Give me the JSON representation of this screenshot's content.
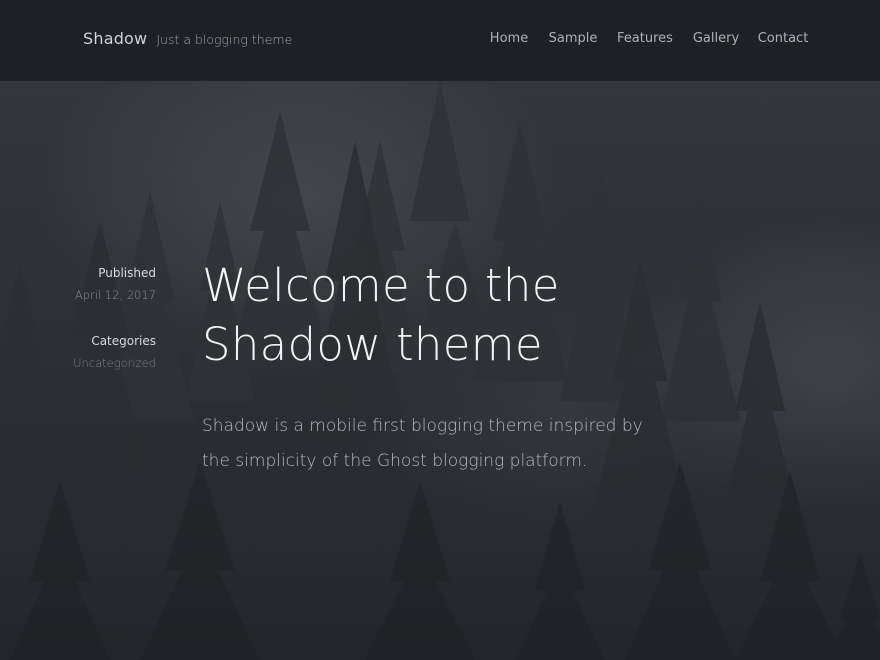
{
  "site": {
    "title": "Shadow",
    "tagline": "Just a blogging theme"
  },
  "nav": {
    "items": [
      {
        "label": "Home"
      },
      {
        "label": "Sample"
      },
      {
        "label": "Features"
      },
      {
        "label": "Gallery"
      },
      {
        "label": "Contact"
      }
    ]
  },
  "post": {
    "published_label": "Published",
    "published_date": "April 12, 2017",
    "categories_label": "Categories",
    "category": "Uncategorized",
    "title_line1": "Welcome to the",
    "title_line2": "Shadow theme",
    "excerpt": "Shadow is a mobile first blogging theme inspired by the simplicity of the Ghost blogging platform."
  },
  "colors": {
    "header_bg": "#1d2024",
    "hero_bg": "#2b2e32",
    "title_text": "#f2f3f4",
    "body_text": "#b6b9bd"
  }
}
